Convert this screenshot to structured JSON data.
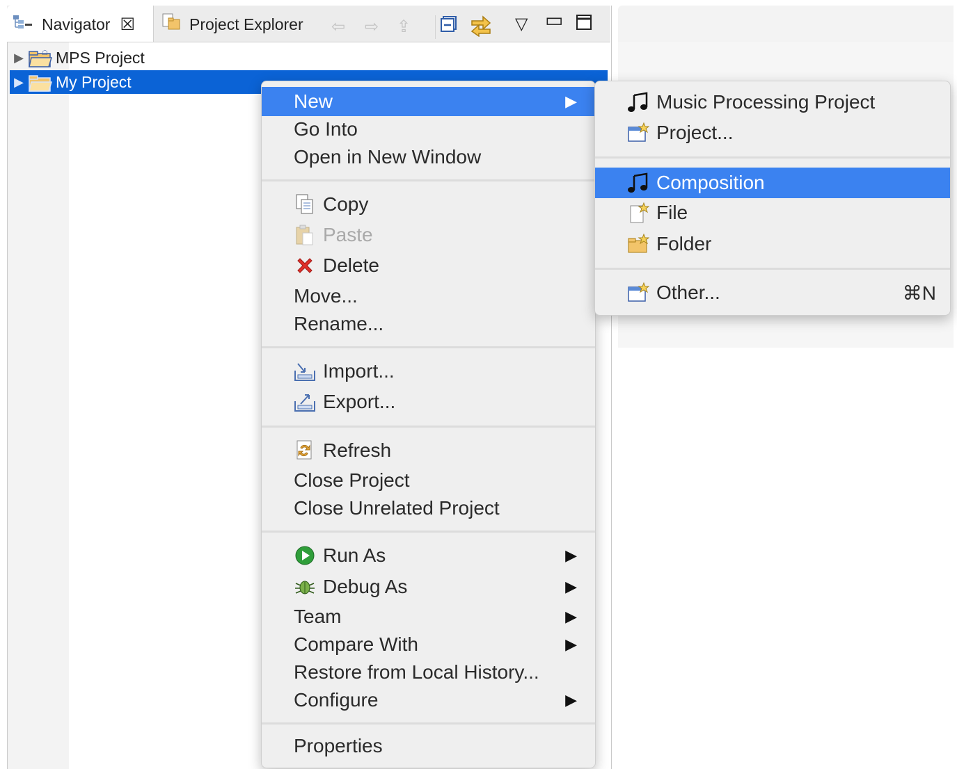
{
  "tabs": {
    "navigator": "Navigator",
    "navigator_close": "☒",
    "project_explorer": "Project Explorer"
  },
  "tree": {
    "items": [
      {
        "label": "MPS Project",
        "selected": false
      },
      {
        "label": "My Project",
        "selected": true
      }
    ]
  },
  "context_menu": {
    "new": "New",
    "go_into": "Go Into",
    "open_new_window": "Open in New Window",
    "copy": "Copy",
    "paste": "Paste",
    "delete": "Delete",
    "move": "Move...",
    "rename": "Rename...",
    "import": "Import...",
    "export": "Export...",
    "refresh": "Refresh",
    "close_project": "Close Project",
    "close_unrelated": "Close Unrelated Project",
    "run_as": "Run As",
    "debug_as": "Debug As",
    "team": "Team",
    "compare_with": "Compare With",
    "restore_history": "Restore from Local History...",
    "configure": "Configure",
    "properties": "Properties"
  },
  "submenu": {
    "music_project": "Music Processing Project",
    "project": "Project...",
    "composition": "Composition",
    "file": "File",
    "folder": "Folder",
    "other": "Other...",
    "other_shortcut": "⌘N"
  },
  "colors": {
    "selection": "#0b63d6",
    "menu_highlight": "#3b82f0",
    "menu_bg": "#efefef"
  }
}
